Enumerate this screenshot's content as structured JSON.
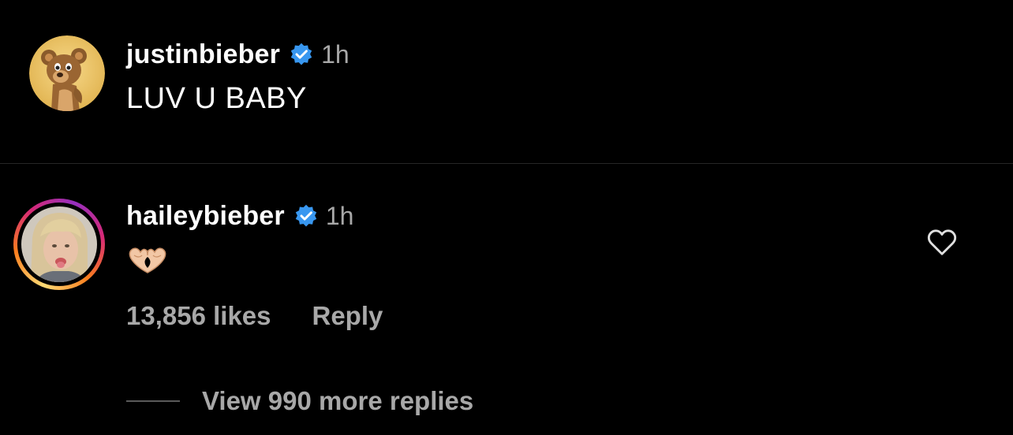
{
  "comments": [
    {
      "username": "justinbieber",
      "verified": true,
      "time": "1h",
      "text": "LUV U BABY",
      "avatar": "teddy-bear-avatar"
    },
    {
      "username": "haileybieber",
      "verified": true,
      "time": "1h",
      "emoji": "heart-hands",
      "avatar": "child-photo-avatar",
      "likes": "13,856 likes",
      "reply_label": "Reply",
      "view_replies_label": "View 990 more replies"
    }
  ],
  "colors": {
    "background": "#000000",
    "verified_blue": "#3897f0",
    "secondary_text": "#a8a8a8",
    "divider": "#262626"
  }
}
